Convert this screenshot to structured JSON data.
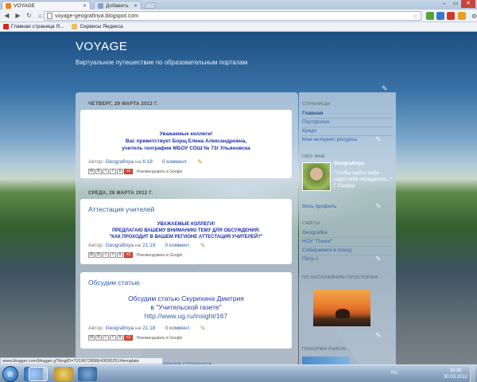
{
  "browser": {
    "tabs": [
      {
        "label": "VOYAGE",
        "active": true
      },
      {
        "label": "Добавить",
        "active": false
      }
    ],
    "url": "voyage-geografinya.blogspot.com",
    "bookmarks": [
      "Главная страница Я...",
      "Сервисы Яндекса"
    ],
    "status_url": "www.blogger.com/blogger.g?blogID=7019972808643095251#template"
  },
  "blog": {
    "title": "VOYAGE",
    "description": "Виртуальное путешествие по образовательным порталам",
    "older_posts": "Главная страница"
  },
  "posts": [
    {
      "date": "ЧЕТВЕРГ, 29 МАРТА 2012 Г.",
      "title": "",
      "body": [
        "Уважаемые коллеги!",
        "Вас приветствует Борщ Елена Александровна,",
        "учитель географии МБОУ СОШ № 73г Ульяновска"
      ],
      "author_label": "Автор:",
      "author": "Geografinya",
      "time_label": "на",
      "time": "6:18",
      "comments": "0 коммент.",
      "recommend": "Рекомендовать в Google"
    },
    {
      "date": "СРЕДА, 28 МАРТА 2012 Г.",
      "title": "Аттестация учителей",
      "body": [
        "УВАЖАЕМЫЕ КОЛЛЕГИ!",
        "ПРЕДЛАГАЮ ВАШЕМУ ВНИМАНИЮ ТЕМУ ДЛЯ ОБСУЖДЕНИЯ:",
        "\"КАК ПРОХОДИТ В ВАШЕМ РЕГИОНЕ АТТЕСТАЦИЯ УЧИТЕЛЕЙ?\""
      ],
      "author_label": "Автор:",
      "author": "Geografinya",
      "time_label": "на",
      "time": "21:19",
      "comments": "0 коммент.",
      "recommend": "Рекомендовать в Google"
    },
    {
      "date": "",
      "title": "Обсудим статью",
      "body": [
        "Обсудим статью Скурихина Дмитрия",
        "в  \"Учительской газете\"",
        "http://www.ug.ru/insight/167"
      ],
      "author_label": "Автор:",
      "author": "Geografinya",
      "time_label": "на",
      "time": "21:18",
      "comments": "0 коммент.",
      "recommend": "Рекомендовать в Google"
    }
  ],
  "sidebar": {
    "pages_heading": "СТРАНИЦЫ",
    "pages": [
      "Главная",
      "Портфолио",
      "Кредо",
      "Мои интернет ресурсы"
    ],
    "about_heading": "ОБО МНЕ",
    "profile_name": "Geografinya",
    "profile_quote": "\"Чтобы найти себя - надо себя переделать..\" Г.Ландау",
    "full_profile": "Весь профиль",
    "sites_heading": "САЙТЫ",
    "sites": [
      "Geografika",
      "НОУ \"Поиск\"",
      "Собираемся в поход",
      "Пётр-1"
    ],
    "travel_heading": "ПО БЕСКРАЙНИМ ПРОСТОРАМ...",
    "fish_heading": "ПОКОРМИ РЫБОК..."
  },
  "taskbar": {
    "lang": "RU",
    "time": "18:38",
    "date": "30.03.2012"
  },
  "colors": {
    "link": "#2d5ea8",
    "post_body": "#1a2ea8",
    "close_button": "#c8433a"
  }
}
